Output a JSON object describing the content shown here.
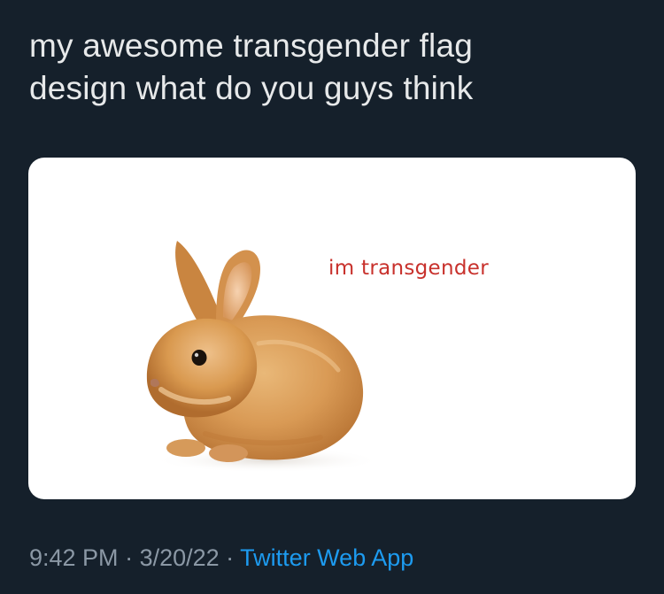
{
  "tweet": {
    "text_line1": "my awesome transgender flag",
    "text_line2": "design what do you guys think"
  },
  "media": {
    "caption": "im transgender",
    "subject": "bunny"
  },
  "meta": {
    "time": "9:42 PM",
    "sep1": " · ",
    "date": "3/20/22",
    "sep2": " · ",
    "source": "Twitter Web App"
  },
  "colors": {
    "background": "#15202b",
    "text": "#e7e9ea",
    "muted": "#8b98a5",
    "link": "#1d9bf0",
    "caption": "#c8312c"
  }
}
